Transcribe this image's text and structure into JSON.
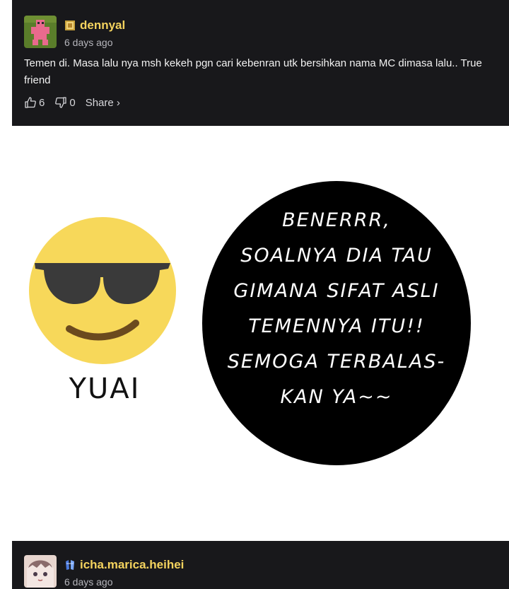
{
  "comment1": {
    "username": "dennyal",
    "time": "6 days ago",
    "text": "Temen di. Masa lalu nya msh kekeh pgn cari kebenran utk bersihkan nama MC dimasa lalu.. True friend",
    "likes": "6",
    "dislikes": "0",
    "share_label": "Share ›",
    "username_color": "#f4d35e"
  },
  "meme": {
    "emoji_caption": "YUAI",
    "bubble_lines": [
      "BENERRR,",
      "SOALNYA DIA TAU",
      "GIMANA SIFAT ASLI",
      "TEMENNYA ITU!!",
      "SEMOGA TERBALAS-",
      "KAN YA~~"
    ]
  },
  "comment2": {
    "username": "icha.marica.heihei",
    "time": "6 days ago",
    "username_color": "#f4d35e"
  },
  "icons": {
    "like": "thumbs-up-icon",
    "dislike": "thumbs-down-icon",
    "badge1": "gold-badge-icon",
    "badge2": "blue-crystal-badge-icon"
  }
}
